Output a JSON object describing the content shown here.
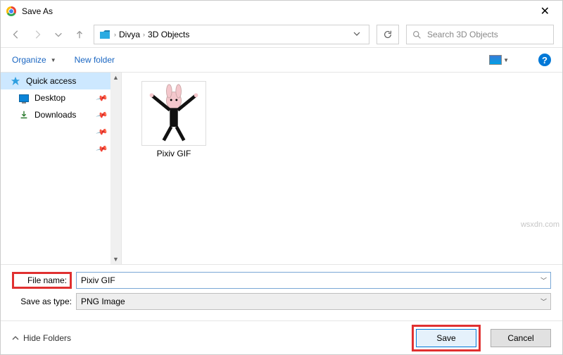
{
  "titlebar": {
    "title": "Save As",
    "close_glyph": "✕"
  },
  "nav": {
    "breadcrumb": {
      "seg1": "Divya",
      "seg2": "3D Objects"
    },
    "search_placeholder": "Search 3D Objects"
  },
  "toolbar": {
    "organize": "Organize",
    "new_folder": "New folder",
    "help_glyph": "?"
  },
  "sidebar": {
    "quick_access": "Quick access",
    "desktop": "Desktop",
    "downloads": "Downloads"
  },
  "content": {
    "files": [
      {
        "label": "Pixiv GIF"
      }
    ]
  },
  "fields": {
    "file_name_label": "File name:",
    "file_name_value": "Pixiv GIF",
    "save_type_label": "Save as type:",
    "save_type_value": "PNG Image"
  },
  "footer": {
    "hide_folders": "Hide Folders",
    "save": "Save",
    "cancel": "Cancel"
  },
  "watermark": "wsxdn.com"
}
